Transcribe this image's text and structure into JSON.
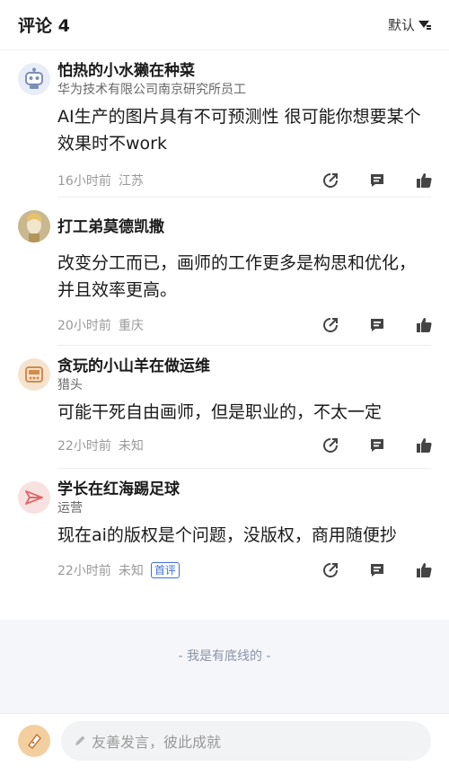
{
  "header": {
    "title": "评论 4",
    "sort_label": "默认"
  },
  "comments": [
    {
      "name": "怕热的小水獭在种菜",
      "role": "华为技术有限公司南京研究所员工",
      "text": "AI生产的图片具有不可预测性 很可能你想要某个效果时不work",
      "time": "16小时前",
      "location": "江苏",
      "avatar_icon": "robot-icon",
      "avatar_color": "#e8edf7"
    },
    {
      "name": "打工弟莫德凯撒",
      "role": "",
      "text": "改变分工而已，画师的工作更多是构思和优化，并且效率更高。",
      "time": "20小时前",
      "location": "重庆",
      "avatar_icon": "character-icon",
      "avatar_color": "#ece5d7"
    },
    {
      "name": "贪玩的小山羊在做运维",
      "role": "猎头",
      "text": "可能干死自由画师，但是职业的，不太一定",
      "time": "22小时前",
      "location": "未知",
      "avatar_icon": "radio-icon",
      "avatar_color": "#f6e3cf"
    },
    {
      "name": "学长在红海踢足球",
      "role": "运营",
      "text": "现在ai的版权是个问题，没版权，商用随便抄",
      "time": "22小时前",
      "location": "未知",
      "badge": "首评",
      "avatar_icon": "paper-plane-icon",
      "avatar_color": "#f8e1e1"
    }
  ],
  "footer": {
    "bottom_text": "- 我是有底线的 -"
  },
  "input": {
    "placeholder": "友善发言，彼此成就"
  },
  "colors": {
    "accent": "#3f6fd6",
    "meta": "#999999",
    "footer_bg": "#f4f6fa"
  }
}
